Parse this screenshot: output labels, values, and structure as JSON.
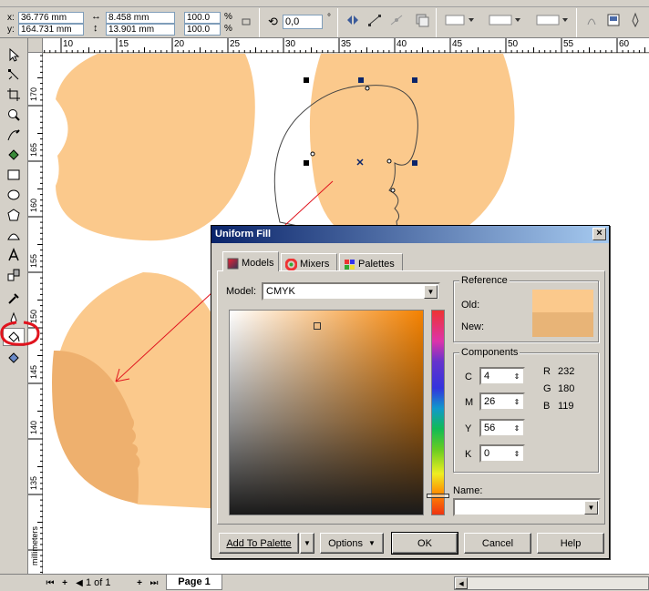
{
  "property_bar": {
    "x_label": "x:",
    "x_value": "36.776 mm",
    "y_label": "y:",
    "y_value": "164.731 mm",
    "width_value": "8.458 mm",
    "height_value": "13.901 mm",
    "scale_x": "100.0",
    "scale_y": "100.0",
    "percent": "%",
    "rotation_value": "0,0",
    "degree": "°"
  },
  "ruler_top": [
    "10",
    "15",
    "20",
    "25",
    "30",
    "35",
    "40",
    "45",
    "50",
    "55",
    "60"
  ],
  "ruler_left": [
    "170",
    "165",
    "160",
    "155",
    "150",
    "145",
    "140",
    "135"
  ],
  "ruler_unit": "millimeters",
  "status_bar": {
    "page_count": "1 of 1",
    "page_tab": "Page 1"
  },
  "dialog": {
    "title": "Uniform Fill",
    "close_label": "×",
    "tabs": [
      {
        "label": "Models"
      },
      {
        "label": "Mixers"
      },
      {
        "label": "Palettes"
      }
    ],
    "model_label": "Model:",
    "model_value": "CMYK",
    "reference": {
      "title": "Reference",
      "old_label": "Old:",
      "new_label": "New:",
      "old_color": "#fbc98c",
      "new_color": "#e8b477"
    },
    "components": {
      "title": "Components",
      "c_label": "C",
      "c_value": "4",
      "m_label": "M",
      "m_value": "26",
      "y_label": "Y",
      "y_value": "56",
      "k_label": "K",
      "k_value": "0",
      "r_label": "R",
      "r_value": "232",
      "g_label": "G",
      "g_value": "180",
      "b_label": "B",
      "b_value": "119"
    },
    "name_label": "Name:",
    "name_value": "",
    "buttons": {
      "add_to_palette": "Add To Palette",
      "options": "Options",
      "ok": "OK",
      "cancel": "Cancel",
      "help": "Help"
    }
  },
  "colors": {
    "skin": "#fbc98c",
    "skin_shadow": "#eeb06e",
    "annotation_red": "#e0141e",
    "selection_node": "#0a246a"
  }
}
